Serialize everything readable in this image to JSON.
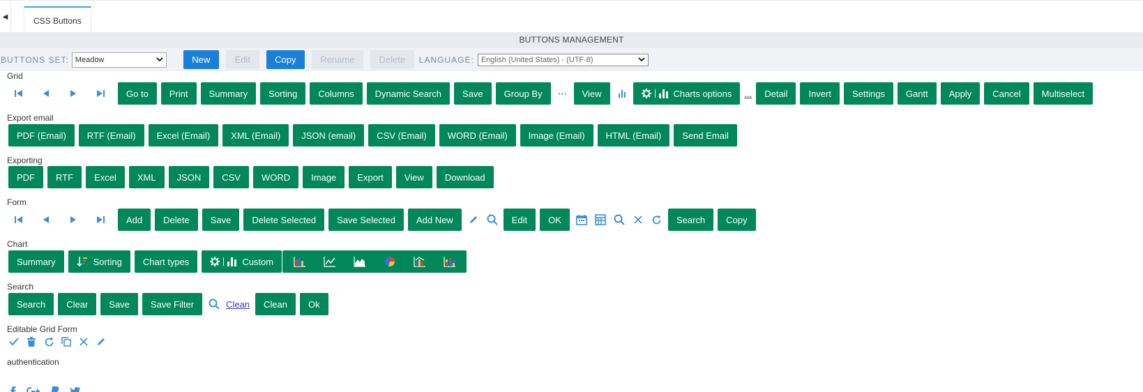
{
  "tab": {
    "label": "CSS Buttons"
  },
  "header": {
    "title": "BUTTONS MANAGEMENT"
  },
  "toolbar": {
    "buttons_set_label": "BUTTONS SET:",
    "buttons_set_value": "Meadow",
    "new": "New",
    "edit": "Edit",
    "copy": "Copy",
    "rename": "Rename",
    "delete": "Delete",
    "language_label": "LANGUAGE:",
    "language_value": "English (United States) - (UTF-8)"
  },
  "sections": {
    "grid": {
      "label": "Grid",
      "goto": "Go to",
      "print": "Print",
      "summary": "Summary",
      "sorting": "Sorting",
      "columns": "Columns",
      "dynamic_search": "Dynamic Search",
      "save": "Save",
      "group_by": "Group By",
      "more": "···",
      "view": "View",
      "charts_options": "Charts options",
      "dots_link": "...",
      "detail": "Detail",
      "invert": "Invert",
      "settings": "Settings",
      "gantt": "Gantt",
      "apply": "Apply",
      "cancel": "Cancel",
      "multiselect": "Multiselect"
    },
    "export_email": {
      "label": "Export email",
      "buttons": [
        "PDF (Email)",
        "RTF (Email)",
        "Excel (Email)",
        "XML (Email)",
        "JSON (email)",
        "CSV (Email)",
        "WORD (Email)",
        "Image (Email)",
        "HTML (Email)",
        "Send Email"
      ]
    },
    "exporting": {
      "label": "Exporting",
      "buttons": [
        "PDF",
        "RTF",
        "Excel",
        "XML",
        "JSON",
        "CSV",
        "WORD",
        "Image",
        "Export",
        "View",
        "Download"
      ]
    },
    "form": {
      "label": "Form",
      "add": "Add",
      "delete": "Delete",
      "save": "Save",
      "delete_selected": "Delete Selected",
      "save_selected": "Save Selected",
      "add_new": "Add New",
      "edit": "Edit",
      "ok": "OK",
      "search": "Search",
      "copy": "Copy"
    },
    "chart": {
      "label": "Chart",
      "summary": "Summary",
      "sorting": "Sorting",
      "chart_types": "Chart types",
      "custom": "Custom"
    },
    "search": {
      "label": "Search",
      "search": "Search",
      "clear": "Clear",
      "save": "Save",
      "save_filter": "Save Filter",
      "clean_link": "Clean",
      "clean": "Clean",
      "ok": "Ok"
    },
    "editable_grid_form": {
      "label": "Editable Grid Form"
    },
    "authentication": {
      "label": "authentication"
    }
  },
  "colors": {
    "button_green": "#00875a",
    "toolbar_blue": "#1a7fd8",
    "icon_blue": "#3b8ed6",
    "tab_accent": "#3aa6d6"
  }
}
